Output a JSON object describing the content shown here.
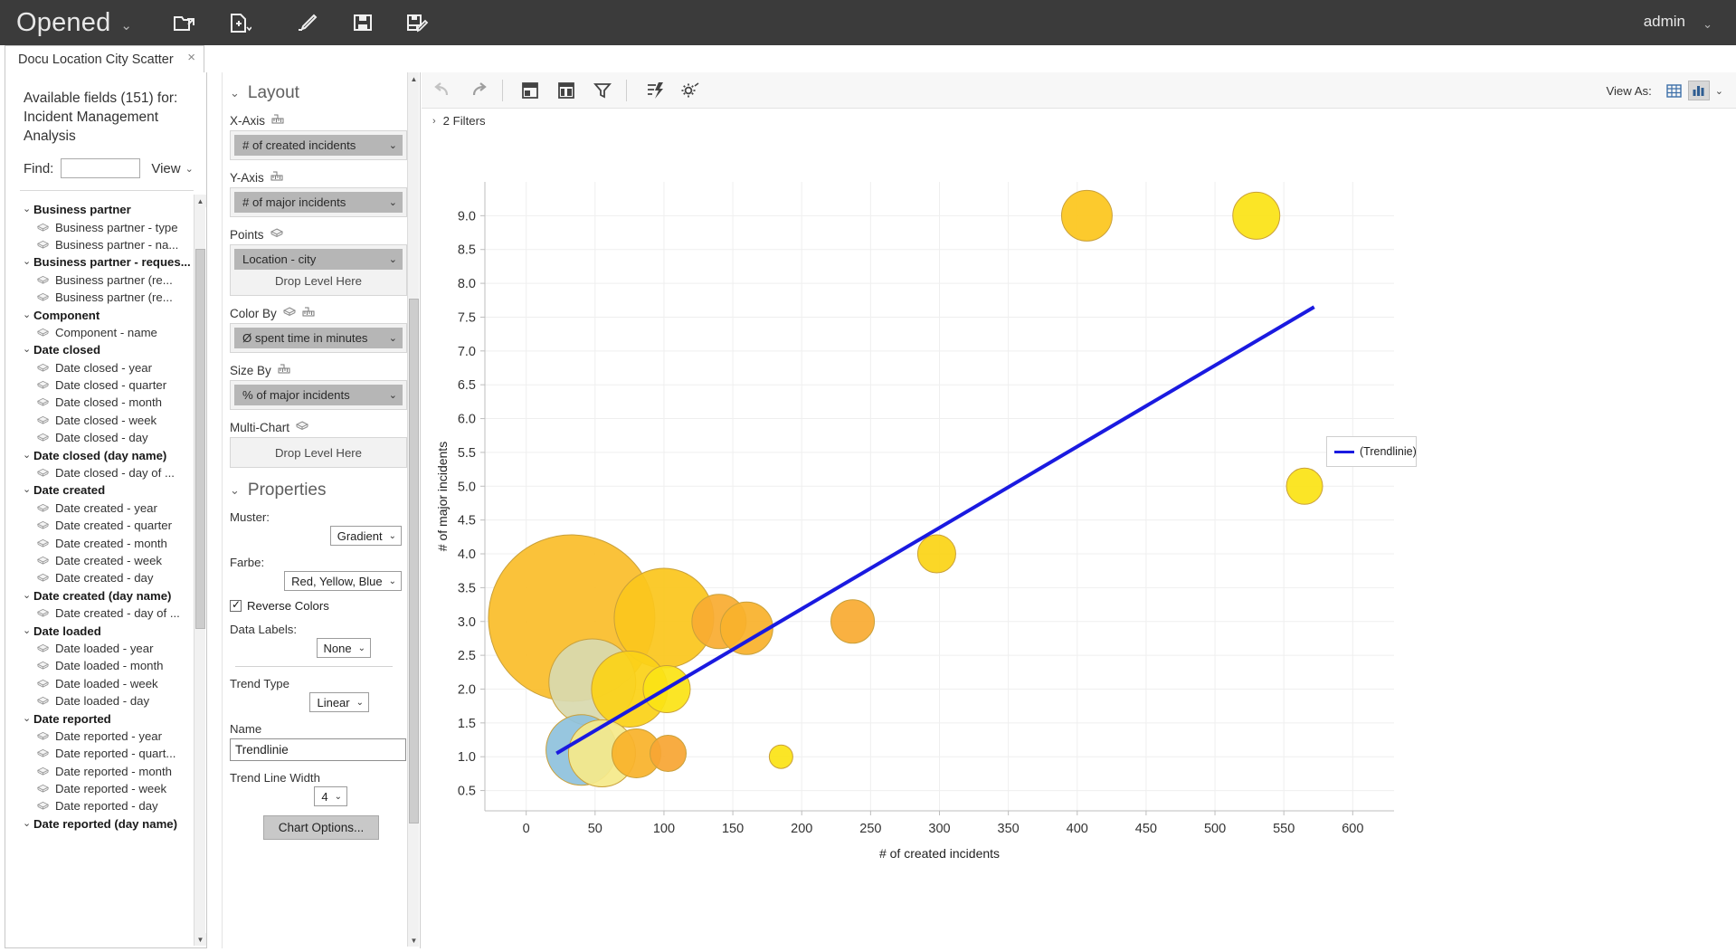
{
  "topbar": {
    "title": "Opened",
    "title_caret": "⌄",
    "user": "admin",
    "user_caret": "⌄",
    "icons": [
      {
        "name": "open-folder-icon",
        "label": "Open"
      },
      {
        "name": "new-document-icon",
        "label": "New"
      },
      {
        "name": "edit-pencil-icon",
        "label": "Edit"
      },
      {
        "name": "save-icon",
        "label": "Save"
      },
      {
        "name": "save-as-icon",
        "label": "Save As"
      }
    ]
  },
  "tab": {
    "label": "Docu Location City Scatter",
    "close": "×"
  },
  "fieldpanel": {
    "heading": "Available fields (151) for: Incident Management Analysis",
    "find_label": "Find:",
    "find_value": "",
    "find_placeholder": "",
    "view_label": "View",
    "view_caret": "⌄",
    "tree": [
      {
        "type": "group",
        "label": "Business partner"
      },
      {
        "type": "item",
        "label": "Business partner - type"
      },
      {
        "type": "item",
        "label": "Business partner - na..."
      },
      {
        "type": "group",
        "label": "Business partner - reques..."
      },
      {
        "type": "item",
        "label": "Business partner (re..."
      },
      {
        "type": "item",
        "label": "Business partner (re..."
      },
      {
        "type": "group",
        "label": "Component"
      },
      {
        "type": "item",
        "label": "Component - name"
      },
      {
        "type": "group",
        "label": "Date closed"
      },
      {
        "type": "item",
        "label": "Date closed - year"
      },
      {
        "type": "item",
        "label": "Date closed - quarter"
      },
      {
        "type": "item",
        "label": "Date closed - month"
      },
      {
        "type": "item",
        "label": "Date closed - week"
      },
      {
        "type": "item",
        "label": "Date closed - day"
      },
      {
        "type": "group",
        "label": "Date closed (day name)"
      },
      {
        "type": "item",
        "label": "Date closed - day of ..."
      },
      {
        "type": "group",
        "label": "Date created"
      },
      {
        "type": "item",
        "label": "Date created - year"
      },
      {
        "type": "item",
        "label": "Date created - quarter"
      },
      {
        "type": "item",
        "label": "Date created - month"
      },
      {
        "type": "item",
        "label": "Date created - week"
      },
      {
        "type": "item",
        "label": "Date created - day"
      },
      {
        "type": "group",
        "label": "Date created (day name)"
      },
      {
        "type": "item",
        "label": "Date created - day of ..."
      },
      {
        "type": "group",
        "label": "Date loaded"
      },
      {
        "type": "item",
        "label": "Date loaded - year"
      },
      {
        "type": "item",
        "label": "Date loaded - month"
      },
      {
        "type": "item",
        "label": "Date loaded - week"
      },
      {
        "type": "item",
        "label": "Date loaded - day"
      },
      {
        "type": "group",
        "label": "Date reported"
      },
      {
        "type": "item",
        "label": "Date reported - year"
      },
      {
        "type": "item",
        "label": "Date reported - quart..."
      },
      {
        "type": "item",
        "label": "Date reported - month"
      },
      {
        "type": "item",
        "label": "Date reported - week"
      },
      {
        "type": "item",
        "label": "Date reported - day"
      },
      {
        "type": "group",
        "label": "Date reported (day name)"
      }
    ]
  },
  "layout": {
    "section_title": "Layout",
    "caret": "⌄",
    "x_axis": {
      "label": "X-Axis",
      "value": "# of created incidents",
      "caret": "⌄"
    },
    "y_axis": {
      "label": "Y-Axis",
      "value": "# of major incidents",
      "caret": "⌄"
    },
    "points": {
      "label": "Points",
      "value": "Location - city",
      "caret": "⌄",
      "drop_hint": "Drop Level Here"
    },
    "color_by": {
      "label": "Color By",
      "value": "Ø spent time in minutes",
      "caret": "⌄"
    },
    "size_by": {
      "label": "Size By",
      "value": "% of major incidents",
      "caret": "⌄"
    },
    "multi_chart": {
      "label": "Multi-Chart",
      "drop_hint": "Drop Level Here"
    }
  },
  "properties": {
    "section_title": "Properties",
    "caret": "⌄",
    "muster": {
      "label": "Muster:",
      "value": "Gradient",
      "caret": "⌄"
    },
    "farbe": {
      "label": "Farbe:",
      "value": "Red, Yellow, Blue",
      "caret": "⌄"
    },
    "reverse_colors": {
      "label": "Reverse Colors",
      "checked": true
    },
    "data_labels": {
      "label": "Data Labels:",
      "value": "None",
      "caret": "⌄"
    },
    "trend_type": {
      "label": "Trend Type",
      "value": "Linear",
      "caret": "⌄"
    },
    "name": {
      "label": "Name",
      "value": "Trendlinie",
      "placeholder": ""
    },
    "trend_line_width": {
      "label": "Trend Line Width",
      "value": "4",
      "caret": "⌄"
    },
    "chart_options_button": "Chart Options..."
  },
  "chart_toolbar": {
    "undo": "undo-icon",
    "redo": "redo-icon",
    "layout_top": "layout-header-icon",
    "layout_split": "layout-split-icon",
    "filter": "funnel-icon",
    "quick_calc": "lightning-icon",
    "settings": "gear-icon",
    "view_as_label": "View As:",
    "view_as_table": "table-view-icon",
    "view_as_chart": "bar-chart-view-icon",
    "view_as_caret": "⌄"
  },
  "filters": {
    "caret": "›",
    "label": "2 Filters"
  },
  "legend": {
    "entries": [
      {
        "label": "(Trendlinie)",
        "color": "#1a1ae0"
      }
    ]
  },
  "chart_data": {
    "type": "scatter",
    "title": "",
    "xlabel": "# of created incidents",
    "ylabel": "# of major incidents",
    "xlim": [
      -30,
      630
    ],
    "ylim": [
      0.2,
      9.5
    ],
    "xticks": [
      0,
      50,
      100,
      150,
      200,
      250,
      300,
      350,
      400,
      450,
      500,
      550,
      600
    ],
    "yticks": [
      0.5,
      1.0,
      1.5,
      2.0,
      2.5,
      3.0,
      3.5,
      4.0,
      4.5,
      5.0,
      5.5,
      6.0,
      6.5,
      7.0,
      7.5,
      8.0,
      8.5,
      9.0
    ],
    "grid": true,
    "legend_position": "right",
    "size_field": "% of major incidents",
    "color_field": "Ø spent time in minutes",
    "points_field": "Location - city",
    "points": [
      {
        "x": 407,
        "y": 9.0,
        "r": 28,
        "color": "#fcc61d"
      },
      {
        "x": 530,
        "y": 9.0,
        "r": 26,
        "color": "#fbe316"
      },
      {
        "x": 565,
        "y": 5.0,
        "r": 20,
        "color": "#fbe316"
      },
      {
        "x": 298,
        "y": 4.0,
        "r": 21,
        "color": "#fbd417"
      },
      {
        "x": 33,
        "y": 3.05,
        "r": 92,
        "color": "#fabd2b"
      },
      {
        "x": 100,
        "y": 3.05,
        "r": 55,
        "color": "#fbc61d"
      },
      {
        "x": 140,
        "y": 3.0,
        "r": 30,
        "color": "#f9ac31"
      },
      {
        "x": 160,
        "y": 2.9,
        "r": 29,
        "color": "#f9b22c"
      },
      {
        "x": 237,
        "y": 3.0,
        "r": 24,
        "color": "#f9ab33"
      },
      {
        "x": 48,
        "y": 2.1,
        "r": 48,
        "color": "#d8d9ae"
      },
      {
        "x": 75,
        "y": 2.0,
        "r": 42,
        "color": "#fbd218"
      },
      {
        "x": 102,
        "y": 2.0,
        "r": 26,
        "color": "#fbe316"
      },
      {
        "x": 40,
        "y": 1.1,
        "r": 39,
        "color": "#8fc2dd"
      },
      {
        "x": 55,
        "y": 1.05,
        "r": 37,
        "color": "#f5e98a"
      },
      {
        "x": 80,
        "y": 1.05,
        "r": 27,
        "color": "#f9b32b"
      },
      {
        "x": 103,
        "y": 1.05,
        "r": 20,
        "color": "#f8a634"
      },
      {
        "x": 185,
        "y": 1.0,
        "r": 13,
        "color": "#fbe316"
      }
    ],
    "trendline": {
      "name": "Trendlinie",
      "type": "Linear",
      "color": "#1a1ae0",
      "width": 4,
      "x0": 22,
      "y0": 1.05,
      "x1": 572,
      "y1": 7.65
    }
  }
}
